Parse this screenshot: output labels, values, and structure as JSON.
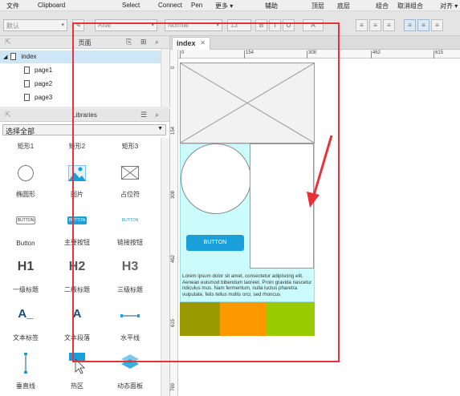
{
  "menubar": {
    "items": [
      "文件",
      "Clipboard",
      "Select",
      "Connect",
      "Pen",
      "更多 ▾",
      "辅助",
      "顶层",
      "底层",
      "组合",
      "取消组合",
      "对齐 ▾"
    ]
  },
  "toolbar": {
    "style_select": "默认",
    "font_select": "Arial",
    "weight_select": "Normal",
    "size_select": "13",
    "bold": "B",
    "italic": "I",
    "underline": "U",
    "fill": "A"
  },
  "pages_panel": {
    "title": "页面",
    "pages": [
      {
        "label": "index",
        "level": 0,
        "selected": true
      },
      {
        "label": "page1",
        "level": 1,
        "selected": false
      },
      {
        "label": "page2",
        "level": 1,
        "selected": false
      },
      {
        "label": "page3",
        "level": 1,
        "selected": false
      }
    ]
  },
  "libraries_panel": {
    "title": "Libraries",
    "select_value": "选择全部",
    "widgets": [
      {
        "label": "矩形1",
        "icon": "rectangle-icon"
      },
      {
        "label": "矩形2",
        "icon": "rectangle-icon"
      },
      {
        "label": "矩形3",
        "icon": "rectangle-icon"
      },
      {
        "label": "椭圆形",
        "icon": "ellipse-icon"
      },
      {
        "label": "图片",
        "icon": "image-icon"
      },
      {
        "label": "占位符",
        "icon": "placeholder-icon"
      },
      {
        "label": "Button",
        "icon": "button-icon",
        "icon_text": "BUTTON"
      },
      {
        "label": "主要按钮",
        "icon": "primary-button-icon",
        "icon_text": "BUTTON"
      },
      {
        "label": "链接按钮",
        "icon": "link-button-icon",
        "icon_text": "BUTTON"
      },
      {
        "label": "一级标题",
        "icon": "h1-icon",
        "icon_text": "H1"
      },
      {
        "label": "二级标题",
        "icon": "h2-icon",
        "icon_text": "H2"
      },
      {
        "label": "三级标题",
        "icon": "h3-icon",
        "icon_text": "H3"
      },
      {
        "label": "文本标签",
        "icon": "text-label-icon",
        "icon_text": "A_"
      },
      {
        "label": "文本段落",
        "icon": "text-paragraph-icon",
        "icon_text": "A"
      },
      {
        "label": "水平线",
        "icon": "horizontal-line-icon"
      },
      {
        "label": "垂直线",
        "icon": "vertical-line-icon"
      },
      {
        "label": "热区",
        "icon": "hotspot-icon"
      },
      {
        "label": "动态面板",
        "icon": "dynamic-panel-icon"
      }
    ]
  },
  "canvas": {
    "tab_label": "index",
    "ruler_h": [
      "0",
      "154",
      "308",
      "462",
      "615"
    ],
    "ruler_v": [
      "0",
      "154",
      "308",
      "462",
      "615",
      "769"
    ],
    "button_text": "BUTTON",
    "lorem_text": "Lorem ipsum dolor sit amet, consectetur adipiscing elit. Aenean euismod bibendum laoreet. Proin gravida nascetur ridiculus mus. Nam fermentum, nulla luctus pharetra vulputate, felis tellus mollis orci, sed rhoncus"
  },
  "colors": {
    "accent_blue": "#199fd9",
    "cyan_fill": "#ccfbfb",
    "olive": "#999900",
    "orange": "#ff9900",
    "green": "#99cc00",
    "annotation_red": "#e8323a"
  }
}
